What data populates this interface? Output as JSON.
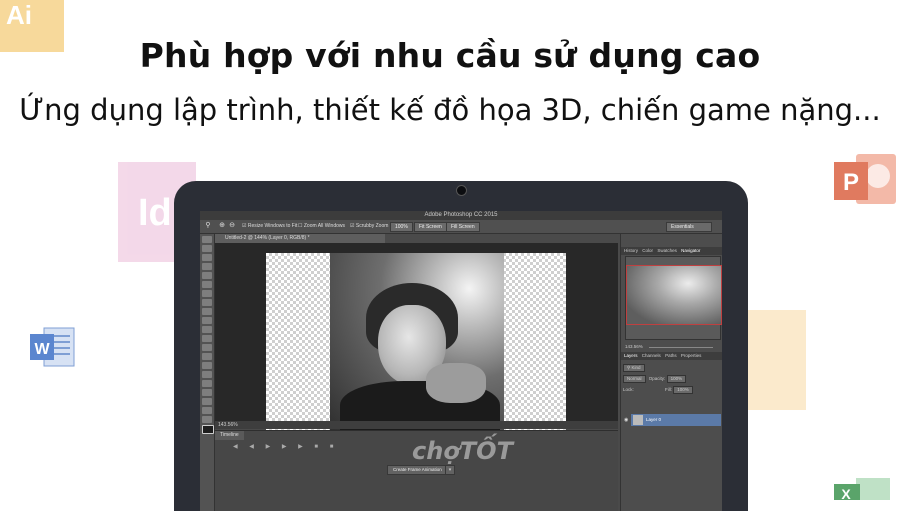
{
  "headline": "Phù hợp với nhu cầu sử dụng cao",
  "subline": "Ứng dụng lập trình, thiết kế đồ họa 3D, chiến game nặng...",
  "decor": {
    "ai_letters": "Ai",
    "id_letters": "Id",
    "word_letter": "W",
    "ppt_letter": "P",
    "excel_letter": "X"
  },
  "watermark": "chợTỐT",
  "photoshop": {
    "window_title": "Adobe Photoshop CC 2015",
    "options": {
      "resize_windows": "Resize Windows to Fit",
      "zoom_all": "Zoom All Windows",
      "scrubby_zoom": "Scrubby Zoom",
      "zoom_100": "100%",
      "fit_screen": "Fit Screen",
      "fill_screen": "Fill Screen",
      "workspace": "Essentials"
    },
    "doc_tab": "Untitled-2 @ 144% (Layer 0, RGB/8) *",
    "status_zoom": "143.56%",
    "timeline_tab": "Timeline",
    "create_frame_btn": "Create Frame Animation",
    "panels": {
      "top_tabs": [
        "History",
        "Color",
        "Swatches",
        "Navigator"
      ],
      "nav_zoom": "143.56%",
      "layer_tabs": [
        "Layers",
        "Channels",
        "Paths",
        "Properties"
      ],
      "kind_label": "Kind",
      "blend_mode": "Normal",
      "opacity_label": "Opacity:",
      "opacity_value": "100%",
      "lock_label": "Lock:",
      "fill_label": "Fill:",
      "fill_value": "100%",
      "layer_name": "Layer 0"
    }
  }
}
